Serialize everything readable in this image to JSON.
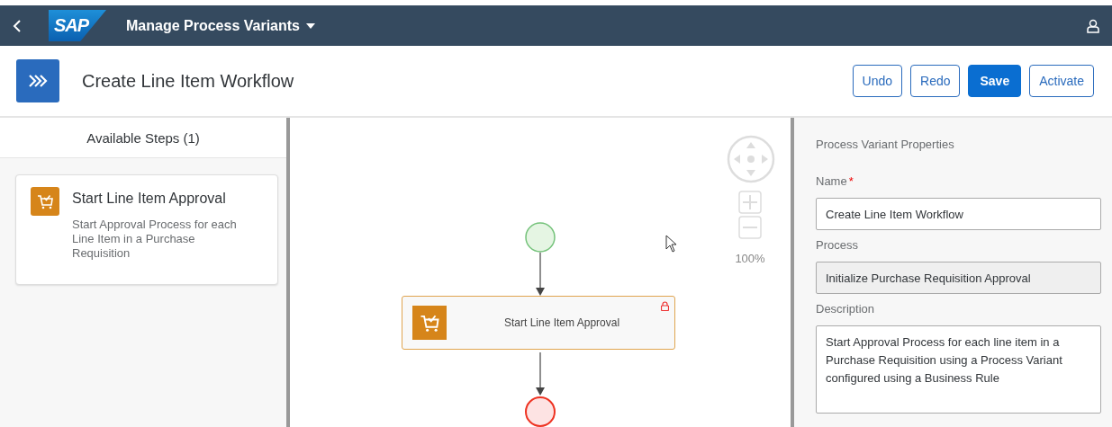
{
  "shell": {
    "logo": "SAP",
    "title": "Manage Process Variants"
  },
  "header": {
    "title": "Create Line Item Workflow",
    "buttons": [
      {
        "label": "Undo",
        "kind": "ghost"
      },
      {
        "label": "Redo",
        "kind": "ghost"
      },
      {
        "label": "Save",
        "kind": "emphasized"
      },
      {
        "label": "Activate",
        "kind": "ghost"
      }
    ]
  },
  "steps_panel": {
    "title": "Available Steps (1)",
    "steps": [
      {
        "title": "Start Line Item Approval",
        "description": "Start Approval Process for each Line Item in a Purchase Requisition"
      }
    ]
  },
  "canvas": {
    "task": {
      "label": "Start Line Item Approval",
      "locked": true
    },
    "zoom": "100%"
  },
  "properties": {
    "title": "Process Variant Properties",
    "fields": [
      {
        "label": "Name",
        "required_mark": "*",
        "value": "Create Line Item Workflow",
        "disabled": false,
        "kind": "input"
      },
      {
        "label": "Process",
        "value": "Initialize Purchase Requisition Approval",
        "disabled": true,
        "kind": "input"
      },
      {
        "label": "Description",
        "value": "Start Approval Process for each line item in a Purchase Requisition using a Process Variant configured using a Business Rule",
        "disabled": false,
        "kind": "textarea"
      }
    ]
  }
}
